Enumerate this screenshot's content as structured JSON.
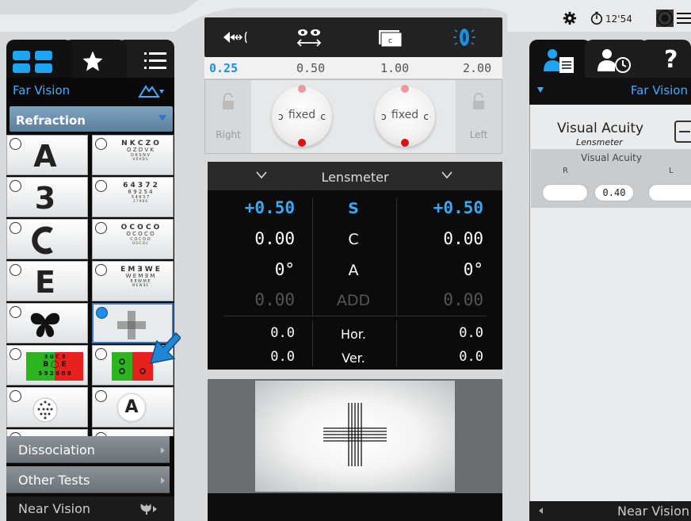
{
  "status": {
    "time": "12'54"
  },
  "left": {
    "header_label": "Far Vision",
    "refraction_label": "Refraction",
    "charts": [
      {
        "type": "letter",
        "text": "A"
      },
      {
        "type": "rows",
        "rows": [
          "N K C Z O",
          "O Z D V K",
          "D K S N V",
          "H R K D S"
        ]
      },
      {
        "type": "letter",
        "text": "3"
      },
      {
        "type": "rows",
        "rows": [
          "6 4 3 7 2",
          "8 9 2 5 4",
          "5 4 6 3 7",
          "2 7 9 8 6"
        ]
      },
      {
        "type": "ring"
      },
      {
        "type": "rows",
        "rows": [
          "O C O C O",
          "O C O C O",
          "C O C O O",
          "O O C O C"
        ]
      },
      {
        "type": "letter",
        "text": "E"
      },
      {
        "type": "rows",
        "rows": [
          "E M Ǝ W E",
          "W E M Ǝ M",
          "E Ǝ W M E",
          "M E W Ǝ E"
        ]
      },
      {
        "type": "butterfly"
      },
      {
        "type": "cross"
      },
      {
        "type": "redgreen-letters",
        "rows": [
          "3 0   C 3",
          "B ◯ E",
          "5 9 2 6 0 8"
        ]
      },
      {
        "type": "redgreen-rings"
      },
      {
        "type": "dots"
      },
      {
        "type": "letter-circle",
        "text": "A"
      },
      {
        "type": "ring-small"
      },
      {
        "type": "blank"
      }
    ],
    "sections": [
      "Dissociation",
      "Other Tests"
    ],
    "near_label": "Near Vision"
  },
  "center": {
    "steps": [
      "0.25",
      "0.50",
      "1.00",
      "2.00"
    ],
    "active_step": "0.25",
    "right_label": "Right",
    "left_label": "Left",
    "dial_label": "fixed"
  },
  "lensmeter": {
    "title": "Lensmeter",
    "rows": [
      {
        "left": "+0.50",
        "mid": "S",
        "right": "+0.50"
      },
      {
        "left": "0.00",
        "mid": "C",
        "right": "0.00"
      },
      {
        "left": "0°",
        "mid": "A",
        "right": "0°"
      },
      {
        "left": "0.00",
        "mid": "ADD",
        "right": "0.00"
      },
      {
        "left": "0.0",
        "mid": "Hor.",
        "right": "0.0"
      },
      {
        "left": "0.0",
        "mid": "Ver.",
        "right": "0.0"
      }
    ]
  },
  "right": {
    "header_label": "Far Vision",
    "va_title": "Visual Acuity",
    "va_subtitle": "Lensmeter",
    "section_header": "Visual Acuity",
    "r_label": "R",
    "l_label": "L",
    "value": "0.40",
    "near_label": "Near Vision"
  },
  "colors": {
    "accent": "#46a9ff",
    "lens_blue": "#3aa8f2",
    "selected_border": "#2f7fd0"
  }
}
